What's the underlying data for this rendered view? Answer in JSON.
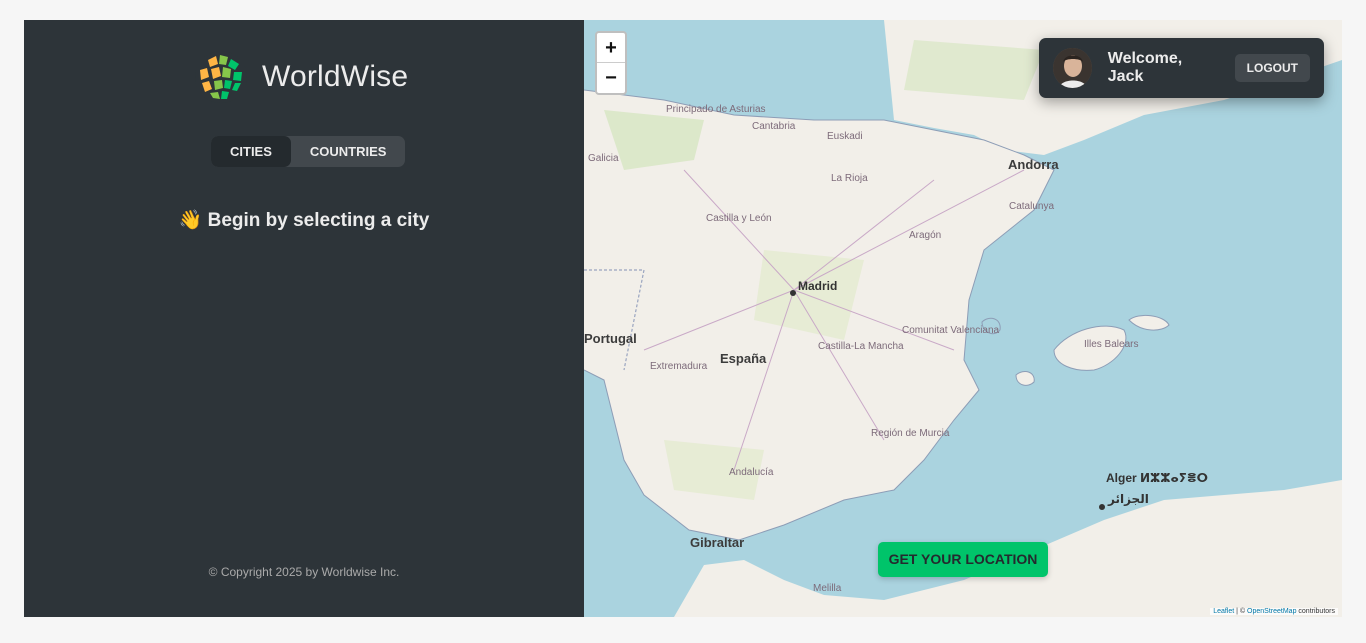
{
  "sidebar": {
    "logo_text": "WorldWise",
    "tabs": [
      {
        "label": "Cities",
        "active": true
      },
      {
        "label": "Countries",
        "active": false
      }
    ],
    "message_emoji": "👋",
    "message": "Begin by selecting a city",
    "copyright": "© Copyright 2025 by Worldwise Inc."
  },
  "map": {
    "zoom_in": "+",
    "zoom_out": "−",
    "location_button": "Get your location",
    "attribution_leaflet": "Leaflet",
    "attribution_sep": " | © ",
    "attribution_osm": "OpenStreetMap",
    "attribution_rest": " contributors",
    "labels": {
      "andorra": "Andorra",
      "madrid": "Madrid",
      "espana": "España",
      "portugal": "Portugal",
      "gibraltar": "Gibraltar",
      "alger": "Alger ⵍⵣⵣⴰⵢⴻⵔ",
      "aljazair": "الجزائر",
      "asturias": "Principado de Asturias",
      "cantabria": "Cantabria",
      "euskadi": "Euskadi",
      "galicia": "Galicia",
      "larioja": "La Rioja",
      "castillaleon": "Castilla y León",
      "aragon": "Aragón",
      "catalunya": "Catalunya",
      "valenciana": "Comunitat Valenciana",
      "castillamancha": "Castilla-La Mancha",
      "extremadura": "Extremadura",
      "murcia": "Región de Murcia",
      "andalucia": "Andalucía",
      "baleares": "Illes Balears",
      "melilla": "Melilla"
    }
  },
  "user": {
    "welcome": "Welcome, Jack",
    "logout": "Logout"
  },
  "colors": {
    "sidebar_bg": "#2d3439",
    "accent_green": "#00c46a",
    "sea": "#aad3df",
    "land": "#f2efe9"
  }
}
